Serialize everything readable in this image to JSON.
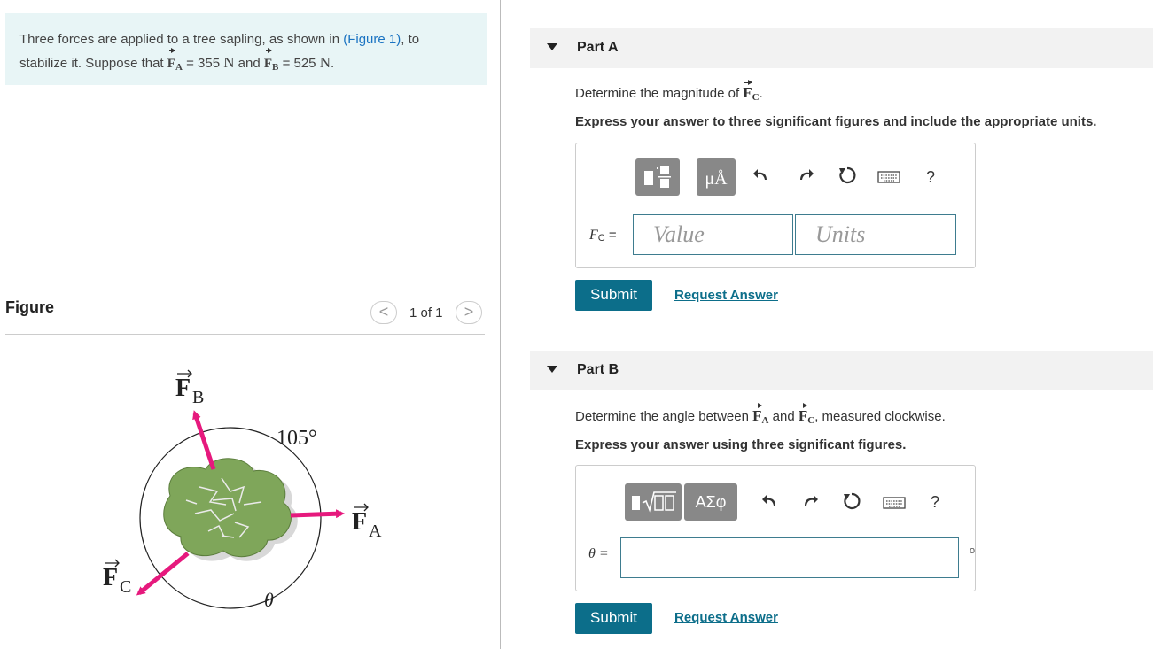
{
  "problem": {
    "text_1": "Three forces are applied to a tree sapling, as shown in",
    "figure_link": "(Figure 1)",
    "text_2": ", to",
    "text_3": "stabilize it. Suppose that",
    "fa_label": "F",
    "fa_sub": "A",
    "fa_value": "= 355",
    "fa_unit": "N",
    "and": "and",
    "fb_label": "F",
    "fb_sub": "B",
    "fb_value": "= 525",
    "fb_unit": "N",
    "period": "."
  },
  "figure": {
    "title": "Figure",
    "pager": "1 of 1",
    "prev": "<",
    "next": ">",
    "fb_letter": "F",
    "fb_sub": "B",
    "fa_letter": "F",
    "fa_sub": "A",
    "fc_letter": "F",
    "fc_sub": "C",
    "angle_label": "105°",
    "theta_label": "θ"
  },
  "part_a": {
    "title": "Part A",
    "question_prefix": "Determine the magnitude of",
    "question_vec": "F",
    "question_sub": "C",
    "question_suffix": ".",
    "instruction": "Express your answer to three significant figures and include the appropriate units.",
    "units_btn": "μÅ",
    "help": "?",
    "var_label": "F",
    "var_sub": "C",
    "eq": "=",
    "value_placeholder": "Value",
    "units_placeholder": "Units",
    "submit": "Submit",
    "request": "Request Answer"
  },
  "part_b": {
    "title": "Part B",
    "question_prefix": "Determine the angle between",
    "vec1": "F",
    "vec1_sub": "A",
    "and": "and",
    "vec2": "F",
    "vec2_sub": "C",
    "question_suffix": ", measured clockwise.",
    "instruction": "Express your answer using three significant figures.",
    "symbols_btn": "ΑΣφ",
    "help": "?",
    "var_label": "θ =",
    "degree": "o",
    "submit": "Submit",
    "request": "Request Answer"
  },
  "colors": {
    "accent": "#0c6e8a",
    "problem_bg": "#e8f5f6",
    "force_arrow": "#e6197d",
    "tree": "#7fa65a"
  }
}
